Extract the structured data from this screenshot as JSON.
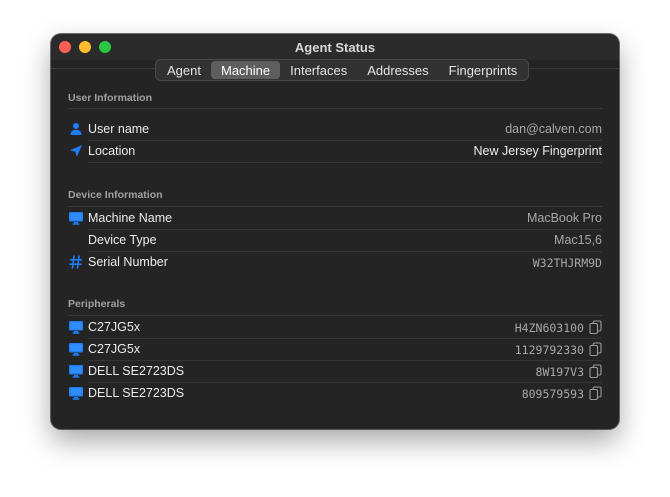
{
  "window": {
    "title": "Agent Status"
  },
  "tabs": [
    {
      "label": "Agent"
    },
    {
      "label": "Machine",
      "active": true
    },
    {
      "label": "Interfaces"
    },
    {
      "label": "Addresses"
    },
    {
      "label": "Fingerprints"
    }
  ],
  "user_info": {
    "header": "User Information",
    "username": {
      "label": "User name",
      "value": "dan@calven.com"
    },
    "location": {
      "label": "Location",
      "value": "New Jersey Fingerprint"
    }
  },
  "device_info": {
    "header": "Device Information",
    "machine_name": {
      "label": "Machine Name",
      "value": "MacBook Pro"
    },
    "device_type": {
      "label": "Device Type",
      "value": "Mac15,6"
    },
    "serial": {
      "label": "Serial Number",
      "value": "W32THJRM9D"
    }
  },
  "peripherals": {
    "header": "Peripherals",
    "items": [
      {
        "name": "C27JG5x",
        "serial": "H4ZN603100"
      },
      {
        "name": "C27JG5x",
        "serial": "1129792330"
      },
      {
        "name": "DELL SE2723DS",
        "serial": "8W197V3"
      },
      {
        "name": "DELL SE2723DS",
        "serial": "809579593"
      }
    ]
  },
  "colors": {
    "accent": "#1f7cf5",
    "window_bg": "#242424",
    "close": "#fe5f57",
    "minimize": "#febc2e",
    "maximize": "#28c840"
  },
  "icons": {
    "user": "person-icon",
    "location": "location-arrow-icon",
    "machine": "monitor-icon",
    "serial": "hash-icon",
    "copy": "copy-icon"
  }
}
